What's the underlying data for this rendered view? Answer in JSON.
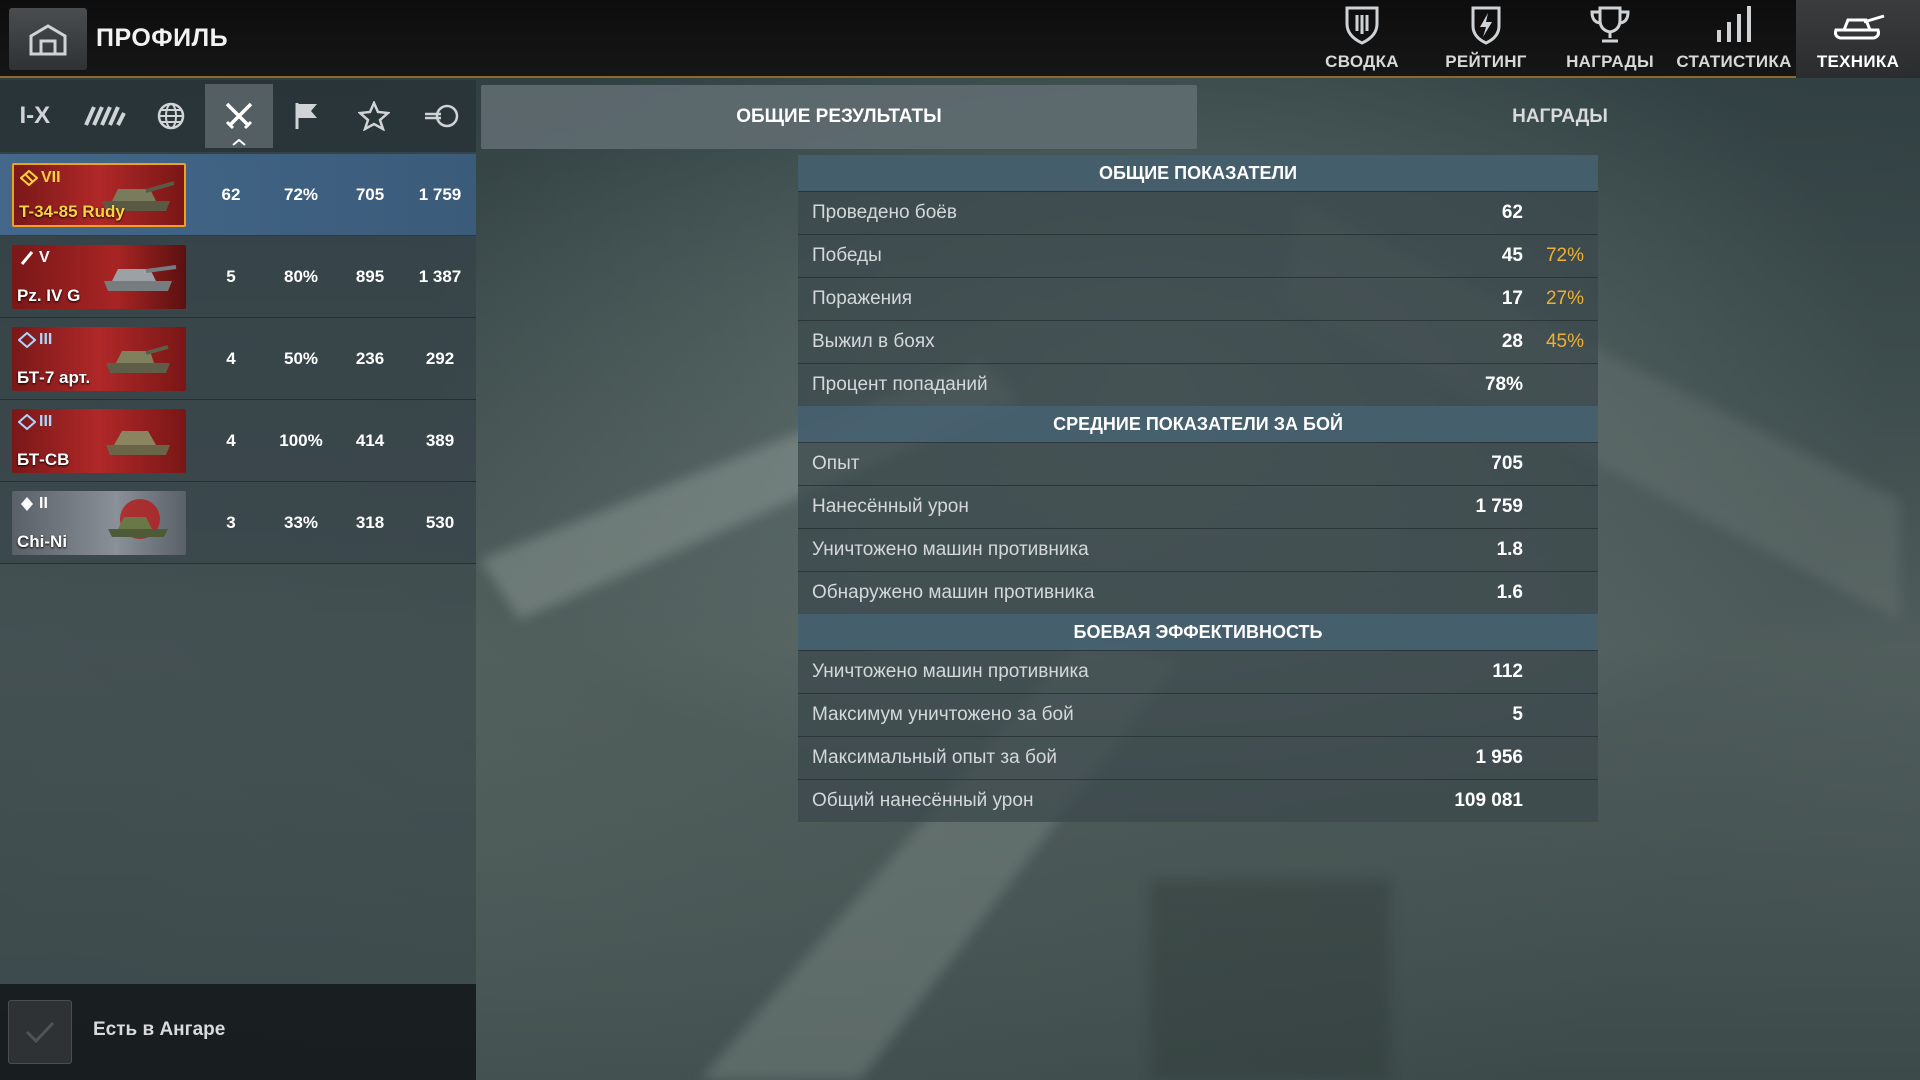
{
  "header": {
    "title": "ПРОФИЛЬ",
    "nav": [
      {
        "label": "СВОДКА",
        "icon": "shield-icon",
        "active": false
      },
      {
        "label": "РЕЙТИНГ",
        "icon": "rating-shield-icon",
        "active": false
      },
      {
        "label": "НАГРАДЫ",
        "icon": "trophy-icon",
        "active": false
      },
      {
        "label": "СТАТИСТИКА",
        "icon": "bars-icon",
        "active": false
      },
      {
        "label": "ТЕХНИКА",
        "icon": "tank-icon",
        "active": true
      }
    ]
  },
  "filters": {
    "tier_label": "I-X",
    "icons": [
      "tank-class-icon",
      "globe-icon",
      "crossed-swords-icon",
      "flag-icon",
      "star-icon",
      "tank-gun-icon"
    ],
    "active_index": 2
  },
  "vehicles": [
    {
      "tier": "VII",
      "name": "T-34-85 Rudy",
      "battles": "62",
      "wins": "72%",
      "xp": "705",
      "damage": "1 759",
      "selected": true,
      "nation": "ussr",
      "tier_color": "gold"
    },
    {
      "tier": "V",
      "name": "Pz. IV G",
      "battles": "5",
      "wins": "80%",
      "xp": "895",
      "damage": "1 387",
      "selected": false,
      "nation": "germany",
      "tier_color": "white"
    },
    {
      "tier": "III",
      "name": "БТ-7 арт.",
      "battles": "4",
      "wins": "50%",
      "xp": "236",
      "damage": "292",
      "selected": false,
      "nation": "ussr",
      "tier_color": "blue"
    },
    {
      "tier": "III",
      "name": "БТ-СВ",
      "battles": "4",
      "wins": "100%",
      "xp": "414",
      "damage": "389",
      "selected": false,
      "nation": "ussr",
      "tier_color": "blue"
    },
    {
      "tier": "II",
      "name": "Chi-Ni",
      "battles": "3",
      "wins": "33%",
      "xp": "318",
      "damage": "530",
      "selected": false,
      "nation": "japan",
      "tier_color": "white"
    }
  ],
  "footer": {
    "checkbox_label": "Есть в Ангаре",
    "checked": true
  },
  "tabs": {
    "general": "ОБЩИЕ РЕЗУЛЬТАТЫ",
    "awards": "НАГРАДЫ"
  },
  "sections": [
    {
      "title": "ОБЩИЕ ПОКАЗАТЕЛИ",
      "rows": [
        {
          "label": "Проведено боёв",
          "value": "62",
          "percent": ""
        },
        {
          "label": "Победы",
          "value": "45",
          "percent": "72%"
        },
        {
          "label": "Поражения",
          "value": "17",
          "percent": "27%"
        },
        {
          "label": "Выжил в боях",
          "value": "28",
          "percent": "45%"
        },
        {
          "label": "Процент попаданий",
          "value": "78%",
          "percent": ""
        }
      ]
    },
    {
      "title": "СРЕДНИЕ ПОКАЗАТЕЛИ ЗА БОЙ",
      "rows": [
        {
          "label": "Опыт",
          "value": "705",
          "percent": ""
        },
        {
          "label": "Нанесённый урон",
          "value": "1 759",
          "percent": ""
        },
        {
          "label": "Уничтожено машин противника",
          "value": "1.8",
          "percent": ""
        },
        {
          "label": "Обнаружено машин противника",
          "value": "1.6",
          "percent": ""
        }
      ]
    },
    {
      "title": "БОЕВАЯ ЭФФЕКТИВНОСТЬ",
      "rows": [
        {
          "label": "Уничтожено машин противника",
          "value": "112",
          "percent": ""
        },
        {
          "label": "Максимум уничтожено за бой",
          "value": "5",
          "percent": ""
        },
        {
          "label": "Максимальный опыт за бой",
          "value": "1 956",
          "percent": ""
        },
        {
          "label": "Общий нанесённый урон",
          "value": "109 081",
          "percent": ""
        }
      ]
    }
  ],
  "colors": {
    "accent_gold": "#f0a020",
    "percent_text": "#f0b030",
    "selected_row": "#46698f",
    "section_header": "#465f6e"
  }
}
